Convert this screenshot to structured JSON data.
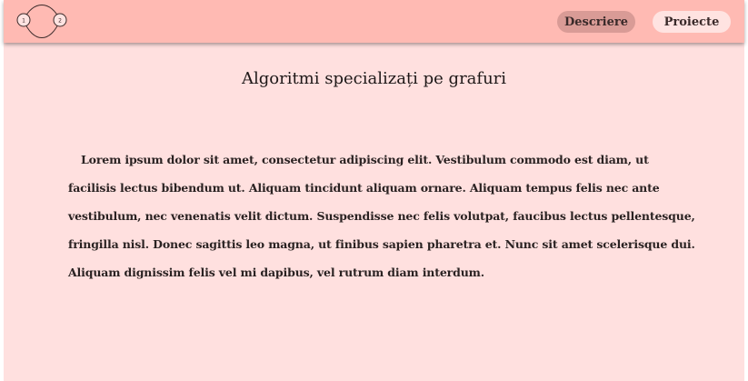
{
  "header": {
    "logo": {
      "node_1": "1",
      "node_2": "2"
    },
    "nav": {
      "descriere": "Descriere",
      "proiecte": "Proiecte"
    },
    "colors": {
      "header_bg": "#ffbab3",
      "page_bg": "#ffe0df",
      "active_button": "#d99b96",
      "inactive_button": "#ffe3e1"
    }
  },
  "main": {
    "title": "Algoritmi specializați pe grafuri",
    "body": "Lorem ipsum dolor sit amet, consectetur adipiscing elit. Vestibulum commodo est diam, ut facilisis lectus bibendum ut. Aliquam tincidunt aliquam ornare. Aliquam tempus felis nec ante vestibulum, nec venenatis velit dictum. Suspendisse nec felis volutpat, faucibus lectus pellentesque, fringilla nisl. Donec sagittis leo magna, ut finibus sapien pharetra et. Nunc sit amet scelerisque dui. Aliquam dignissim felis vel mi dapibus, vel rutrum diam interdum."
  }
}
